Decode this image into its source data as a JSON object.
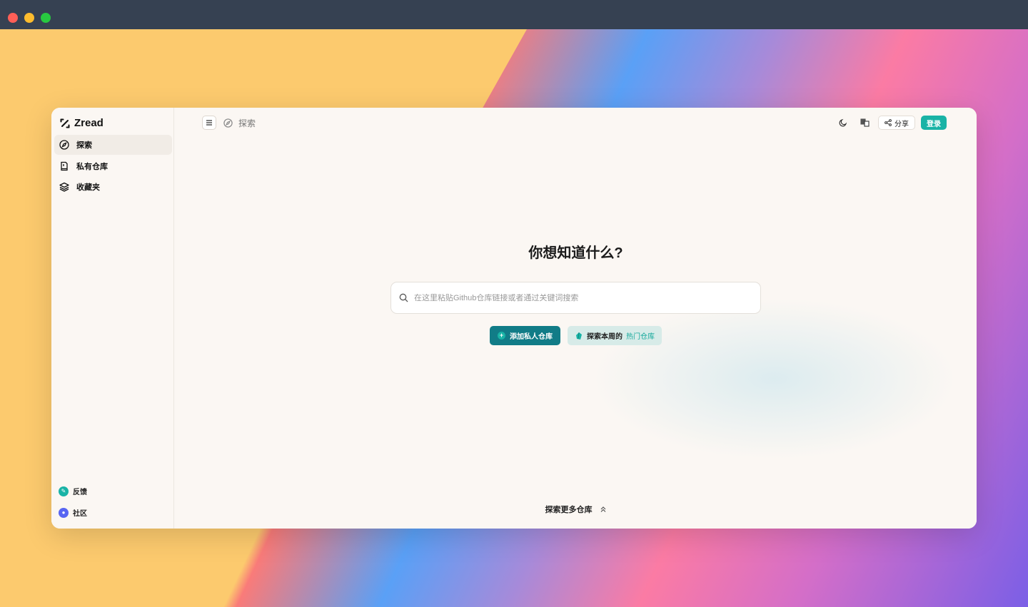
{
  "app": {
    "name": "Zread"
  },
  "sidebar": {
    "items": [
      {
        "label": "探索",
        "icon": "compass-icon",
        "active": true
      },
      {
        "label": "私有仓库",
        "icon": "repo-icon",
        "active": false
      },
      {
        "label": "收藏夹",
        "icon": "layers-icon",
        "active": false
      }
    ],
    "footer": [
      {
        "label": "反馈",
        "icon": "feedback-icon",
        "color": "#19b3a6"
      },
      {
        "label": "社区",
        "icon": "discord-icon",
        "color": "#5865f2"
      }
    ]
  },
  "topbar": {
    "breadcrumb": "探索",
    "share_label": "分享",
    "login_label": "登录"
  },
  "main": {
    "title": "你想知道什么?",
    "search_placeholder": "在这里粘贴Github仓库链接或者通过关键词搜索",
    "add_private_label": "添加私人仓库",
    "explore_prefix": "探索本周的",
    "explore_hot": "热门仓库",
    "explore_more": "探索更多仓库"
  },
  "colors": {
    "accent": "#19b3a6",
    "add_button": "#117c87"
  }
}
